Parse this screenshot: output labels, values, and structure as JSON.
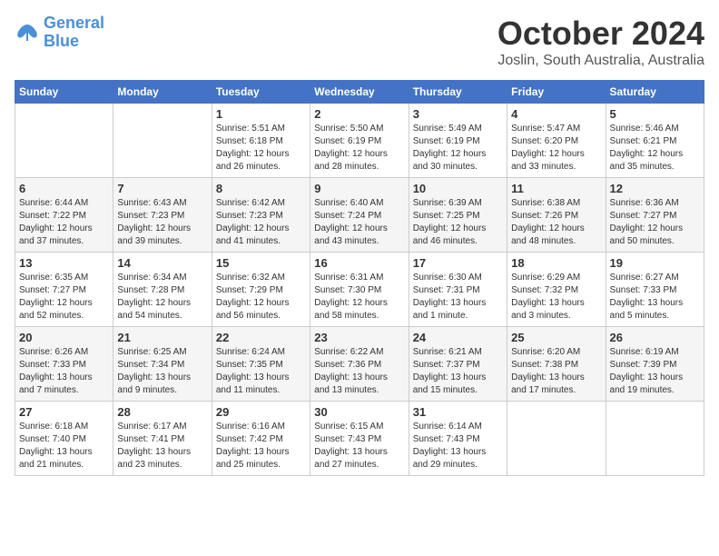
{
  "logo": {
    "text_general": "General",
    "text_blue": "Blue"
  },
  "header": {
    "month": "October 2024",
    "location": "Joslin, South Australia, Australia"
  },
  "weekdays": [
    "Sunday",
    "Monday",
    "Tuesday",
    "Wednesday",
    "Thursday",
    "Friday",
    "Saturday"
  ],
  "weeks": [
    [
      {
        "day": "",
        "info": ""
      },
      {
        "day": "",
        "info": ""
      },
      {
        "day": "1",
        "info": "Sunrise: 5:51 AM\nSunset: 6:18 PM\nDaylight: 12 hours\nand 26 minutes."
      },
      {
        "day": "2",
        "info": "Sunrise: 5:50 AM\nSunset: 6:19 PM\nDaylight: 12 hours\nand 28 minutes."
      },
      {
        "day": "3",
        "info": "Sunrise: 5:49 AM\nSunset: 6:19 PM\nDaylight: 12 hours\nand 30 minutes."
      },
      {
        "day": "4",
        "info": "Sunrise: 5:47 AM\nSunset: 6:20 PM\nDaylight: 12 hours\nand 33 minutes."
      },
      {
        "day": "5",
        "info": "Sunrise: 5:46 AM\nSunset: 6:21 PM\nDaylight: 12 hours\nand 35 minutes."
      }
    ],
    [
      {
        "day": "6",
        "info": "Sunrise: 6:44 AM\nSunset: 7:22 PM\nDaylight: 12 hours\nand 37 minutes."
      },
      {
        "day": "7",
        "info": "Sunrise: 6:43 AM\nSunset: 7:23 PM\nDaylight: 12 hours\nand 39 minutes."
      },
      {
        "day": "8",
        "info": "Sunrise: 6:42 AM\nSunset: 7:23 PM\nDaylight: 12 hours\nand 41 minutes."
      },
      {
        "day": "9",
        "info": "Sunrise: 6:40 AM\nSunset: 7:24 PM\nDaylight: 12 hours\nand 43 minutes."
      },
      {
        "day": "10",
        "info": "Sunrise: 6:39 AM\nSunset: 7:25 PM\nDaylight: 12 hours\nand 46 minutes."
      },
      {
        "day": "11",
        "info": "Sunrise: 6:38 AM\nSunset: 7:26 PM\nDaylight: 12 hours\nand 48 minutes."
      },
      {
        "day": "12",
        "info": "Sunrise: 6:36 AM\nSunset: 7:27 PM\nDaylight: 12 hours\nand 50 minutes."
      }
    ],
    [
      {
        "day": "13",
        "info": "Sunrise: 6:35 AM\nSunset: 7:27 PM\nDaylight: 12 hours\nand 52 minutes."
      },
      {
        "day": "14",
        "info": "Sunrise: 6:34 AM\nSunset: 7:28 PM\nDaylight: 12 hours\nand 54 minutes."
      },
      {
        "day": "15",
        "info": "Sunrise: 6:32 AM\nSunset: 7:29 PM\nDaylight: 12 hours\nand 56 minutes."
      },
      {
        "day": "16",
        "info": "Sunrise: 6:31 AM\nSunset: 7:30 PM\nDaylight: 12 hours\nand 58 minutes."
      },
      {
        "day": "17",
        "info": "Sunrise: 6:30 AM\nSunset: 7:31 PM\nDaylight: 13 hours\nand 1 minute."
      },
      {
        "day": "18",
        "info": "Sunrise: 6:29 AM\nSunset: 7:32 PM\nDaylight: 13 hours\nand 3 minutes."
      },
      {
        "day": "19",
        "info": "Sunrise: 6:27 AM\nSunset: 7:33 PM\nDaylight: 13 hours\nand 5 minutes."
      }
    ],
    [
      {
        "day": "20",
        "info": "Sunrise: 6:26 AM\nSunset: 7:33 PM\nDaylight: 13 hours\nand 7 minutes."
      },
      {
        "day": "21",
        "info": "Sunrise: 6:25 AM\nSunset: 7:34 PM\nDaylight: 13 hours\nand 9 minutes."
      },
      {
        "day": "22",
        "info": "Sunrise: 6:24 AM\nSunset: 7:35 PM\nDaylight: 13 hours\nand 11 minutes."
      },
      {
        "day": "23",
        "info": "Sunrise: 6:22 AM\nSunset: 7:36 PM\nDaylight: 13 hours\nand 13 minutes."
      },
      {
        "day": "24",
        "info": "Sunrise: 6:21 AM\nSunset: 7:37 PM\nDaylight: 13 hours\nand 15 minutes."
      },
      {
        "day": "25",
        "info": "Sunrise: 6:20 AM\nSunset: 7:38 PM\nDaylight: 13 hours\nand 17 minutes."
      },
      {
        "day": "26",
        "info": "Sunrise: 6:19 AM\nSunset: 7:39 PM\nDaylight: 13 hours\nand 19 minutes."
      }
    ],
    [
      {
        "day": "27",
        "info": "Sunrise: 6:18 AM\nSunset: 7:40 PM\nDaylight: 13 hours\nand 21 minutes."
      },
      {
        "day": "28",
        "info": "Sunrise: 6:17 AM\nSunset: 7:41 PM\nDaylight: 13 hours\nand 23 minutes."
      },
      {
        "day": "29",
        "info": "Sunrise: 6:16 AM\nSunset: 7:42 PM\nDaylight: 13 hours\nand 25 minutes."
      },
      {
        "day": "30",
        "info": "Sunrise: 6:15 AM\nSunset: 7:43 PM\nDaylight: 13 hours\nand 27 minutes."
      },
      {
        "day": "31",
        "info": "Sunrise: 6:14 AM\nSunset: 7:43 PM\nDaylight: 13 hours\nand 29 minutes."
      },
      {
        "day": "",
        "info": ""
      },
      {
        "day": "",
        "info": ""
      }
    ]
  ]
}
